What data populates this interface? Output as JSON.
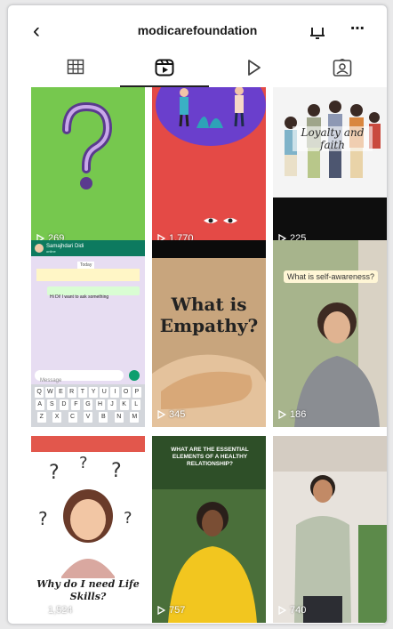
{
  "header": {
    "username": "modicarefoundation"
  },
  "tabs": [
    {
      "name": "grid",
      "icon": "grid-icon"
    },
    {
      "name": "reels",
      "icon": "reels-icon"
    },
    {
      "name": "videos",
      "icon": "play-icon"
    },
    {
      "name": "tagged",
      "icon": "tagged-icon"
    }
  ],
  "posts": [
    {
      "views": "269",
      "caption": "?"
    },
    {
      "views": "1,770",
      "caption": ""
    },
    {
      "views": "225",
      "caption": "Loyalty and faith"
    },
    {
      "views": "",
      "chat_contact": "Samajhdari Didi",
      "chat_status": "online",
      "chat_day": "Today",
      "chat_message": "Hi Di! I want to ask something",
      "chat_input": "Message",
      "caption": ""
    },
    {
      "views": "345",
      "caption": "What is Empathy?"
    },
    {
      "views": "186",
      "caption": "What is self-awareness?"
    },
    {
      "views": "1,524",
      "caption": "Why do I need Life Skills?"
    },
    {
      "views": "757",
      "caption": "WHAT ARE THE ESSENTIAL ELEMENTS OF A HEALTHY RELATIONSHIP?"
    },
    {
      "views": "740",
      "caption": ""
    }
  ],
  "colors": {
    "green_tile": "#76c84e",
    "red_tile": "#e44a46",
    "purple_circle": "#6a3fcc",
    "whatsapp_header": "#0d7a5f",
    "accent_dark": "#111111"
  }
}
